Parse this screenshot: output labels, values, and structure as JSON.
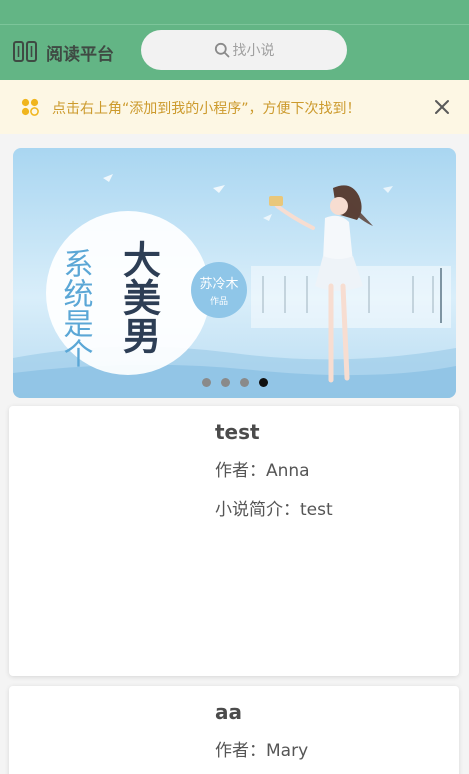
{
  "header": {
    "title": "阅读平台",
    "search_placeholder": "找小说"
  },
  "banner": {
    "text": "点击右上角“添加到我的小程序”，方便下次找到！",
    "close_symbol": "✕"
  },
  "carousel": {
    "slide_text": {
      "title_main": "大美男",
      "title_side": "系统是个",
      "author_badge": "苏冷木",
      "author_badge_sub": "作品"
    },
    "dots_count": 4,
    "active_index": 3
  },
  "books": [
    {
      "title": "test",
      "author_label": "作者：",
      "author": "Anna",
      "intro_label": "小说简介：",
      "intro": "test"
    },
    {
      "title": "aa",
      "author_label": "作者：",
      "author": "Mary"
    }
  ],
  "colors": {
    "header": "#63b585",
    "banner_bg": "#fdf7e4",
    "banner_text": "#cc9a2c",
    "accent_yellow": "#f0b51d"
  }
}
